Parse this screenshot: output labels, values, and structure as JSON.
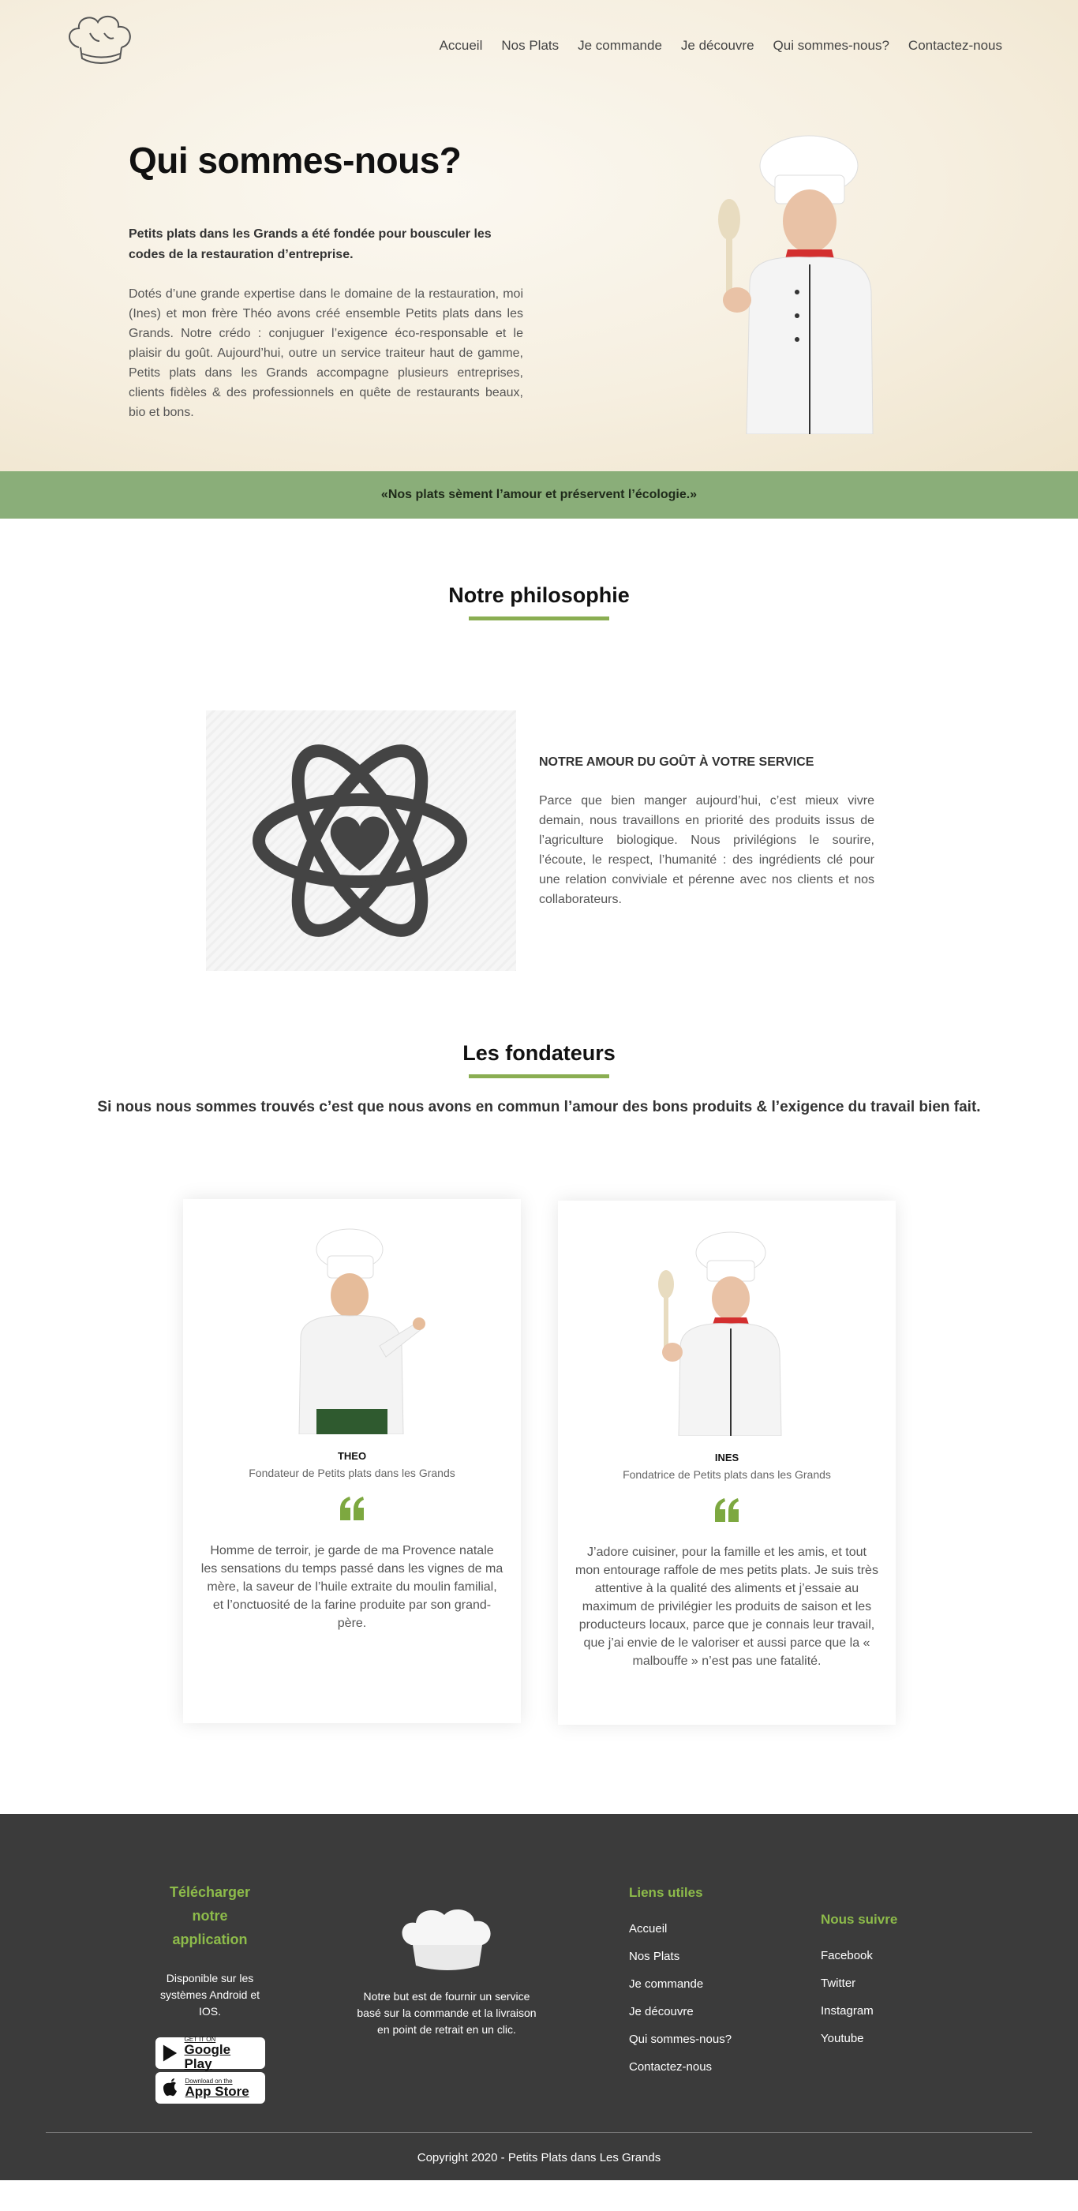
{
  "nav": [
    "Accueil",
    "Nos Plats",
    "Je commande",
    "Je découvre",
    "Qui sommes-nous?",
    "Contactez-nous"
  ],
  "hero": {
    "title": "Qui sommes-nous?",
    "lead": "Petits plats dans les Grands a été fondée pour bousculer les codes de la restauration d’entreprise.",
    "body": "Dotés d’une grande expertise dans le domaine de la restauration, moi (Ines) et mon frère Théo avons créé ensemble Petits plats dans les Grands. Notre crédo : conjuguer l’exigence éco-responsable et le plaisir du goût. Aujourd’hui, outre un service traiteur haut de gamme, Petits plats dans les Grands accompagne plusieurs entreprises, clients fidèles & des professionnels en quête de restaurants beaux, bio et bons."
  },
  "banner": "«Nos plats sèment l’amour et préservent l’écologie.»",
  "philosophy": {
    "title": "Notre philosophie",
    "heading": "NOTRE AMOUR DU GOÛT À VOTRE SERVICE",
    "text": "Parce que bien manger aujourd’hui, c’est mieux vivre demain, nous travaillons en priorité des produits issus de l’agriculture biologique. Nous privilégions le sourire, l’écoute, le respect, l’humanité : des ingrédients clé pour une relation conviviale et pérenne avec nos clients et nos collaborateurs."
  },
  "founders": {
    "title": "Les fondateurs",
    "tagline": "Si nous nous sommes trouvés c’est que nous avons en commun l’amour des bons produits & l’exigence du travail bien fait.",
    "cards": [
      {
        "name": "THEO",
        "role": "Fondateur de Petits plats dans les Grands",
        "text": "Homme de terroir, je garde de ma Provence natale les sensations du temps passé dans les vignes de ma mère, la saveur de l’huile extraite du moulin familial, et l’onctuosité de la farine produite par son grand-père."
      },
      {
        "name": "INES",
        "role": "Fondatrice de Petits plats dans les Grands",
        "text": "J’adore cuisiner, pour la famille et les amis, et tout mon entourage raffole de mes petits plats. Je suis très attentive à la qualité des aliments et j’essaie au maximum de privilégier les produits de saison et les producteurs locaux, parce que je connais leur travail, que j’ai envie de le valoriser et aussi parce que la « malbouffe » n’est pas une fatalité."
      }
    ]
  },
  "footer": {
    "app_title": "Télécharger notre application",
    "app_text": "Disponible sur les systèmes Android et IOS.",
    "google_small": "GET IT ON",
    "google_big": "Google Play",
    "apple_small": "Download on the",
    "apple_big": "App Store",
    "mission": "Notre but est de fournir un service basé sur la commande et la livraison en point de retrait en un clic.",
    "links_title": "Liens utiles",
    "links": [
      "Accueil",
      "Nos Plats",
      "Je commande",
      "Je découvre",
      "Qui sommes-nous?",
      "Contactez-nous"
    ],
    "follow_title": "Nous suivre",
    "social": [
      "Facebook",
      "Twitter",
      "Instagram",
      "Youtube"
    ],
    "copyright": "Copyright 2020 - Petits Plats dans Les Grands"
  },
  "colors": {
    "accent_green": "#8aae52",
    "banner_green": "#8aae79",
    "footer_bg": "#3b3b3b",
    "hero_bg": "#f6efe0"
  }
}
